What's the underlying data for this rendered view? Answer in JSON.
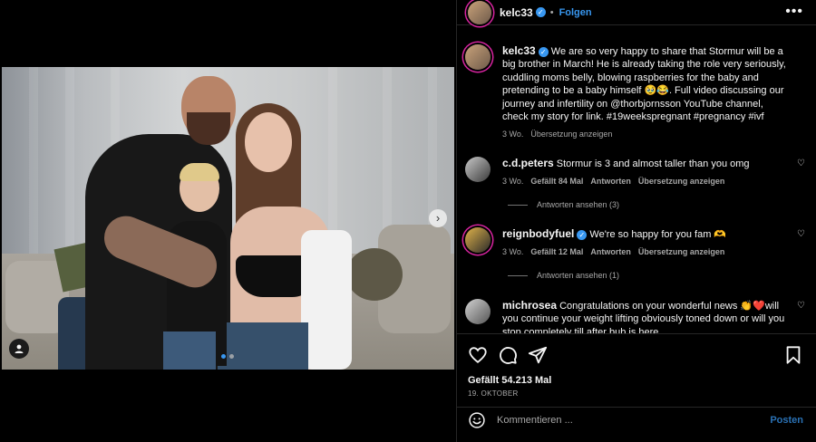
{
  "post": {
    "slide_count": 2,
    "active_slide": 1
  },
  "header": {
    "username": "kelc33",
    "follow_label": "Folgen",
    "more_label": "•••"
  },
  "caption": {
    "username": "kelc33",
    "text": "We are so very happy to share that Stormur will be a big brother in March! He is already taking the role very seriously, cuddling moms belly, blowing raspberries for the baby and pretending to be a baby himself 🥹😂. Full video discussing our journey and infertility on @thorbjornsson YouTube channel, check my story for link. #19weekspregnant #pregnancy #ivf",
    "time": "3 Wo.",
    "translate": "Übersetzung anzeigen"
  },
  "comments": [
    {
      "username": "c.d.peters",
      "text": "Stormur is 3 and almost taller than you omg",
      "time": "3 Wo.",
      "likes": "Gefällt 84 Mal",
      "reply": "Antworten",
      "translate": "Übersetzung anzeigen",
      "view_replies": "Antworten ansehen (3)"
    },
    {
      "username": "reignbodyfuel",
      "text": "We're so happy for you fam 🫶",
      "time": "3 Wo.",
      "likes": "Gefällt 12 Mal",
      "reply": "Antworten",
      "translate": "Übersetzung anzeigen",
      "view_replies": "Antworten ansehen (1)"
    },
    {
      "username": "michrosea",
      "text": "Congratulations on your wonderful news 👏❤️will you continue your weight lifting obviously toned down or will you stop completely till after bub is here"
    }
  ],
  "actions": {
    "likes": "Gefällt 54.213 Mal",
    "date": "19. OKTOBER",
    "comment_placeholder": "Kommentieren ...",
    "post_label": "Posten"
  },
  "colors": {
    "accent": "#3897f0",
    "background": "#000000",
    "secondary_text": "#a8a8a8",
    "story_ring": "#d6249f"
  }
}
